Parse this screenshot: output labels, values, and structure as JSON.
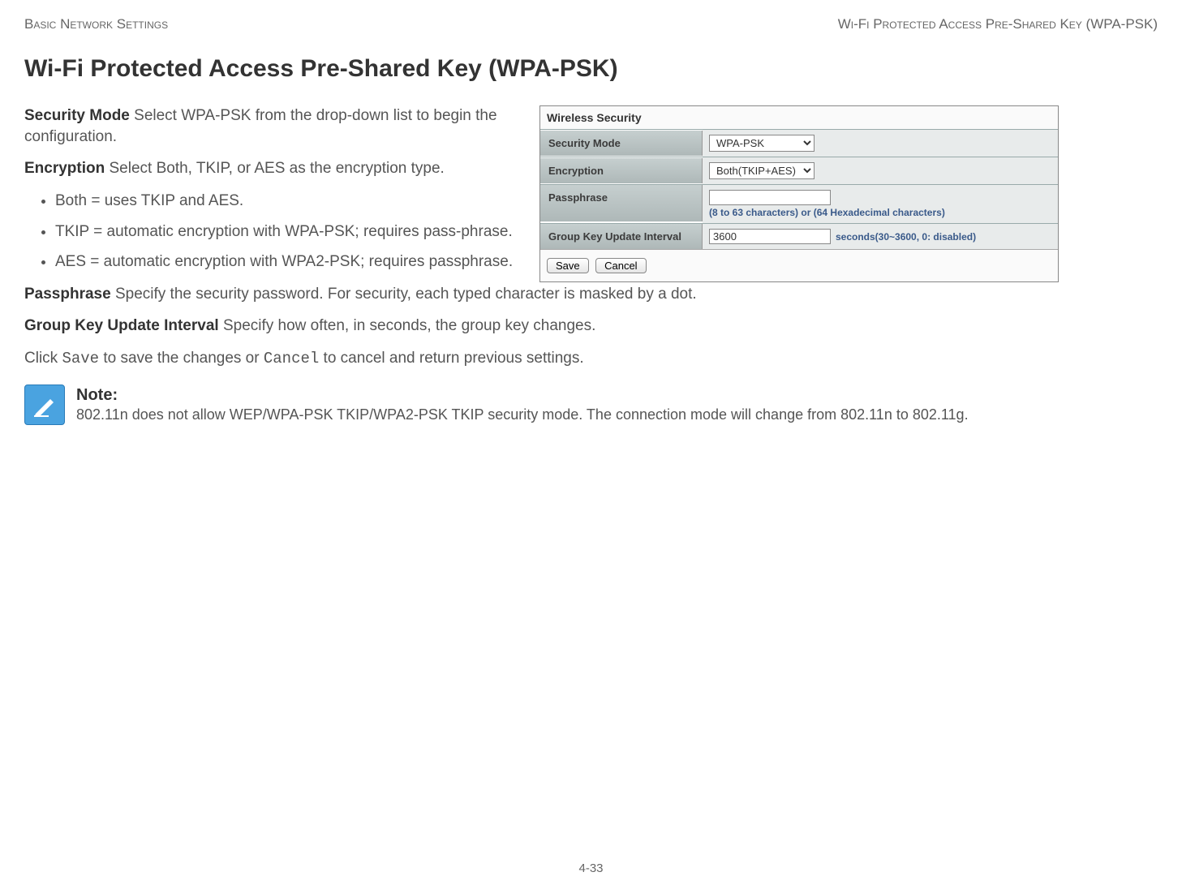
{
  "header": {
    "left": "Basic Network Settings",
    "right": "Wi-Fi Protected Access Pre-Shared Key (WPA-PSK)"
  },
  "title": "Wi-Fi Protected Access Pre-Shared Key (WPA-PSK)",
  "sections": {
    "security_mode": {
      "label": "Security Mode",
      "text": "  Select WPA-PSK from the drop-down list to begin the configuration."
    },
    "encryption": {
      "label": "Encryption",
      "text": "  Select Both, TKIP, or AES as the encryption type.",
      "bullets": [
        "Both = uses TKIP and AES.",
        "TKIP = automatic encryption with WPA-PSK; requires pass-phrase.",
        "AES = automatic encryption with WPA2-PSK; requires passphrase."
      ]
    },
    "passphrase": {
      "label": "Passphrase",
      "text": "  Specify the security password. For security, each typed character is masked by a dot."
    },
    "group_key": {
      "label": "Group Key Update Interval",
      "text": "  Specify how often, in seconds, the group key changes."
    },
    "click_save": {
      "pre": "Click ",
      "save": "Save",
      "mid": " to save the changes or ",
      "cancel": "Cancel",
      "post": " to cancel and return previous settings."
    }
  },
  "screenshot": {
    "title": "Wireless Security",
    "rows": {
      "security_mode": {
        "label": "Security Mode",
        "value": "WPA-PSK"
      },
      "encryption": {
        "label": "Encryption",
        "value": "Both(TKIP+AES)"
      },
      "passphrase": {
        "label": "Passphrase",
        "value": "",
        "hint": "(8 to 63 characters) or (64 Hexadecimal characters)"
      },
      "group_key": {
        "label": "Group Key Update Interval",
        "value": "3600",
        "hint": "seconds(30~3600, 0: disabled)"
      }
    },
    "buttons": {
      "save": "Save",
      "cancel": "Cancel"
    }
  },
  "note": {
    "label": "Note:",
    "text": "802.11n does not allow WEP/WPA-PSK TKIP/WPA2-PSK TKIP security mode. The connection mode will change from 802.11n to 802.11g."
  },
  "footer": "4-33"
}
